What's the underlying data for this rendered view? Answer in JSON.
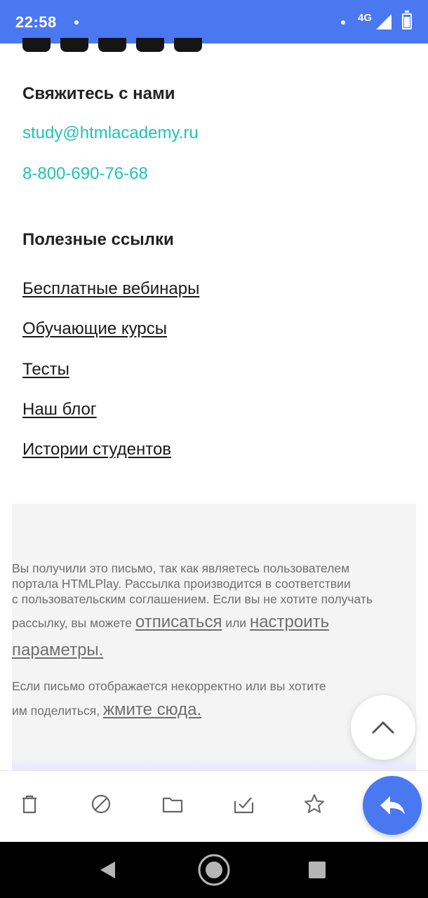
{
  "status_bar": {
    "time": "22:58",
    "network": "4G",
    "color": "#4a78f0"
  },
  "social_icons": [
    "facebook-icon",
    "instagram-icon",
    "youtube-icon",
    "twitter-icon",
    "vk-icon"
  ],
  "contact": {
    "title": "Свяжитесь с нами",
    "email": "study@htmlacademy.ru",
    "phone": "8-800-690-76-68",
    "link_color": "#1ec4b4"
  },
  "useful_links": {
    "title": "Полезные ссылки",
    "items": [
      "Бесплатные вебинары",
      "Обучающие курсы",
      "Тесты",
      "Наш блог",
      "Истории студентов"
    ]
  },
  "notice": {
    "line1": "Вы получили это письмо, так как являетесь пользователем",
    "line2": "портала HTMLPlay. Рассылка производится в соответствии",
    "line3": "с пользовательским соглашением. Если вы не хотите получать",
    "line4_pre": "рассылку, вы можете ",
    "unsubscribe_link": "отписаться",
    "line4_mid": " или ",
    "settings_link_part1": "настроить",
    "settings_link_part2": "параметры.",
    "share_line1": "Если письмо отображается некорректно или вы хотите",
    "share_line2_pre": "им поделиться, ",
    "share_link": "жмите сюда."
  },
  "actions": [
    "delete-icon",
    "spam-icon",
    "move-folder-icon",
    "mark-read-icon",
    "star-icon"
  ],
  "reply_icon": "reply-icon"
}
